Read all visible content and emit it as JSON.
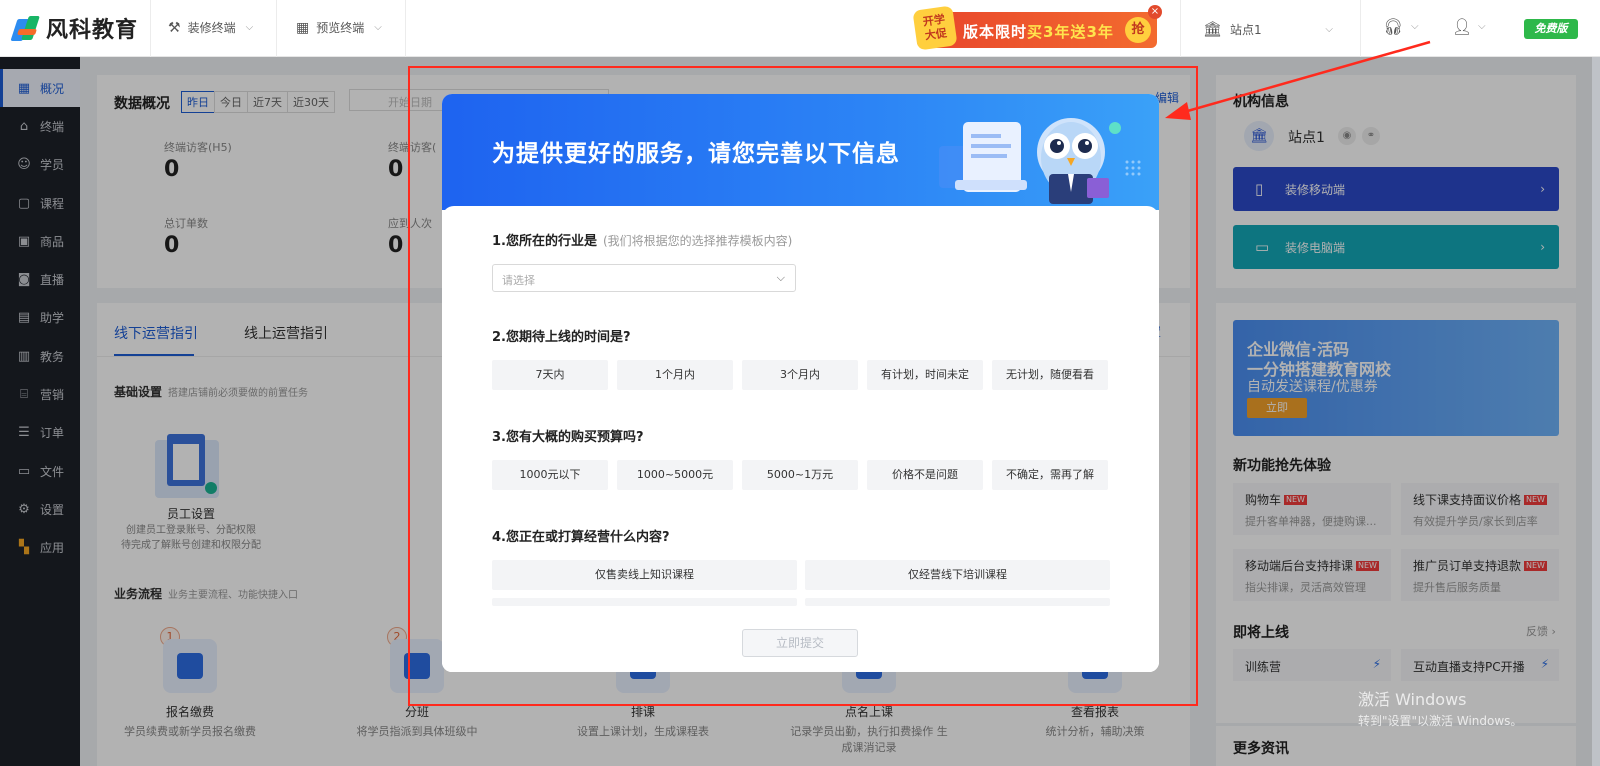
{
  "topbar": {
    "logo_text": "风科教育",
    "menu": [
      {
        "label": "装修终端",
        "icon": "brush-icon"
      },
      {
        "label": "预览终端",
        "icon": "grid-icon"
      }
    ],
    "promo": {
      "badge_line1": "开学",
      "badge_line2": "大促",
      "text_prefix": "版本限时",
      "text_highlight": "买3年送3年",
      "grab": "抢",
      "close": "×"
    },
    "site_select": "站点1",
    "free_badge": "免费版"
  },
  "sidebar": {
    "items": [
      {
        "label": "概况",
        "icon": "grid-icon",
        "active": true
      },
      {
        "label": "终端",
        "icon": "store-icon"
      },
      {
        "label": "学员",
        "icon": "users-icon"
      },
      {
        "label": "课程",
        "icon": "course-icon"
      },
      {
        "label": "商品",
        "icon": "goods-icon"
      },
      {
        "label": "直播",
        "icon": "live-icon"
      },
      {
        "label": "助学",
        "icon": "study-icon"
      },
      {
        "label": "教务",
        "icon": "book-icon"
      },
      {
        "label": "营销",
        "icon": "marketing-icon"
      },
      {
        "label": "订单",
        "icon": "order-icon"
      },
      {
        "label": "文件",
        "icon": "folder-icon"
      },
      {
        "label": "设置",
        "icon": "settings-icon"
      },
      {
        "label": "应用",
        "icon": "apps-icon"
      }
    ]
  },
  "overview": {
    "title": "数据概况",
    "ranges": [
      "昨日",
      "今日",
      "近7天",
      "近30天"
    ],
    "date_placeholder": "开始日期",
    "edit": "编辑",
    "stats": [
      {
        "label": "终端访客(H5)",
        "value": "0"
      },
      {
        "label": "终端访客(",
        "value": "0"
      },
      {
        "label": "总订单数",
        "value": "0"
      },
      {
        "label": "应到人次",
        "value": "0"
      }
    ]
  },
  "guide": {
    "tabs": [
      "线下运营指引",
      "线上运营指引"
    ],
    "right_link": "后置",
    "basic_title": "基础设置",
    "basic_desc": "搭建店铺前必须要做的前置任务",
    "staff_title": "员工设置",
    "staff_desc1": "创建员工登录账号、分配权限",
    "staff_desc2": "待完成了解账号创建和权限分配",
    "flow_title": "业务流程",
    "flow_desc": "业务主要流程、功能快捷入口",
    "flow": [
      {
        "num": "1",
        "title": "报名缴费",
        "desc": "学员续费或新学员报名缴费"
      },
      {
        "num": "2",
        "title": "分班",
        "desc": "将学员指派到具体班级中"
      },
      {
        "num": "",
        "title": "排课",
        "desc": "设置上课计划，生成课程表"
      },
      {
        "num": "",
        "title": "点名上课",
        "desc": "记录学员出勤，执行扣费操作 生成课消记录"
      },
      {
        "num": "",
        "title": "查看报表",
        "desc": "统计分析，辅助决策"
      }
    ]
  },
  "right_panel": {
    "title": "机构信息",
    "site_name": "站点1",
    "btn_mobile": "装修移动端",
    "btn_pc": "装修电脑端",
    "banner_line1": "企业微信·活码",
    "banner_line2": "一分钟搭建教育网校",
    "banner_line3": "自动发送课程/优惠券",
    "banner_btn": "立即",
    "new_title": "新功能抢先体验",
    "new_tag": "NEW",
    "features": [
      {
        "title": "购物车",
        "desc": "提升客单神器，便捷购课..."
      },
      {
        "title": "线下课支持面议价格",
        "desc": "有效提升学员/家长到店率"
      },
      {
        "title": "移动端后台支持排课",
        "desc": "指尖排课，灵活高效管理"
      },
      {
        "title": "推广员订单支持退款",
        "desc": "提升售后服务质量"
      }
    ],
    "soon_title": "即将上线",
    "feedback": "反馈",
    "soon": [
      "训练营",
      "互动直播支持PC开播"
    ],
    "more_title": "更多资讯"
  },
  "modal": {
    "title": "为提供更好的服务，请您完善以下信息",
    "q1": "1.您所在的行业是",
    "q1_hint": "(我们将根据您的选择推荐模板内容)",
    "q1_placeholder": "请选择",
    "q2": "2.您期待上线的时间是?",
    "q2_options": [
      "7天内",
      "1个月内",
      "3个月内",
      "有计划，时间未定",
      "无计划，随便看看"
    ],
    "q3": "3.您有大概的购买预算吗?",
    "q3_options": [
      "1000元以下",
      "1000~5000元",
      "5000~1万元",
      "价格不是问题",
      "不确定，需再了解"
    ],
    "q4": "4.您正在或打算经营什么内容?",
    "q4_options": [
      "仅售卖线上知识课程",
      "仅经营线下培训课程"
    ],
    "submit": "立即提交"
  },
  "watermark": {
    "line1": "激活 Windows",
    "line2": "转到\"设置\"以激活 Windows。"
  },
  "colors": {
    "accent": "#1e5dd6",
    "annotation": "#ff2a1d",
    "modal_header": "#1e63f0",
    "mobile_btn": "#2b49c9",
    "pc_btn": "#13a8b8"
  }
}
